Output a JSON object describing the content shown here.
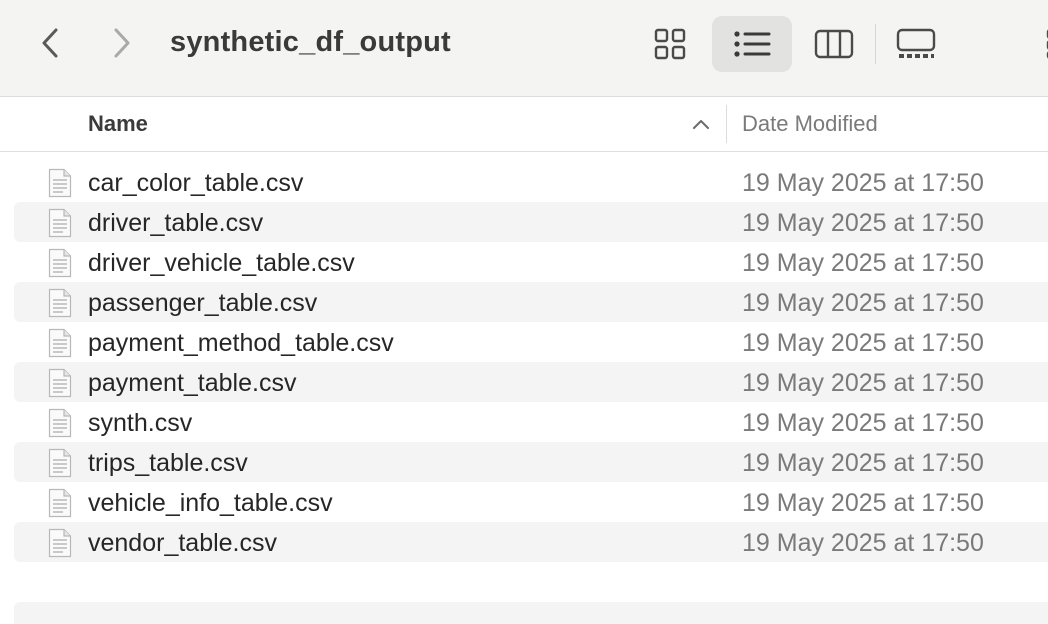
{
  "window": {
    "title": "synthetic_df_output"
  },
  "toolbar": {
    "back_icon": "chevron-left-icon",
    "forward_icon": "chevron-right-icon",
    "view_modes": [
      "icons",
      "list",
      "columns",
      "gallery"
    ],
    "active_view": "list"
  },
  "columns": {
    "name": "Name",
    "date_modified": "Date Modified",
    "sort": "ascending"
  },
  "files": [
    {
      "name": "car_color_table.csv",
      "date": "19 May 2025 at 17:50"
    },
    {
      "name": "driver_table.csv",
      "date": "19 May 2025 at 17:50"
    },
    {
      "name": "driver_vehicle_table.csv",
      "date": "19 May 2025 at 17:50"
    },
    {
      "name": "passenger_table.csv",
      "date": "19 May 2025 at 17:50"
    },
    {
      "name": "payment_method_table.csv",
      "date": "19 May 2025 at 17:50"
    },
    {
      "name": "payment_table.csv",
      "date": "19 May 2025 at 17:50"
    },
    {
      "name": "synth.csv",
      "date": "19 May 2025 at 17:50"
    },
    {
      "name": "trips_table.csv",
      "date": "19 May 2025 at 17:50"
    },
    {
      "name": "vehicle_info_table.csv",
      "date": "19 May 2025 at 17:50"
    },
    {
      "name": "vendor_table.csv",
      "date": "19 May 2025 at 17:50"
    }
  ],
  "colors": {
    "toolbar_bg": "#f4f4f3",
    "alt_row_bg": "#f4f4f4",
    "active_view_bg": "#e2e2e1",
    "text_primary": "#262626",
    "text_secondary": "#7a7a7a"
  }
}
